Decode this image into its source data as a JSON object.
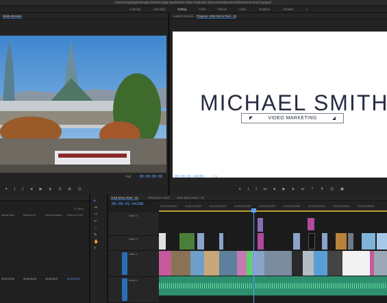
{
  "titlebar": {
    "path": "/Users/Craig/Studio/Dropbox/Work/Craigio Studio/2016 Video Production Demo Reels/premiere/2016 Demo Reel 04.prproj *"
  },
  "workspace_tabs": [
    "Learning",
    "Assembly",
    "Editing",
    "Color",
    "Effects",
    "Audio",
    "Graphics",
    "Libraries",
    "»"
  ],
  "source_panel": {
    "tab": "Media Browser",
    "zoom": "Full",
    "timecode": "00:00:08:08"
  },
  "program_panel": {
    "tabs": [
      "Lumetri Scopes",
      "Program: 2016 Demo Reel - 02"
    ],
    "title": "MICHAEL SMITH",
    "subtitle": "VIDEO MARKETING",
    "timecode": "00:00:01:44188",
    "fit": "Fit"
  },
  "project_panel": {
    "count": "17 Items",
    "columns": [
      "Media Start",
      "Media End",
      "Media Duration",
      "Video In Point"
    ],
    "values": [
      "00;00;00;00",
      "00;00;06;24",
      "00;00;06;27",
      "00;00;00;00"
    ]
  },
  "timeline": {
    "tabs": [
      "2016 Demo Reel - 02",
      "2016 Demo Reel",
      "2016 Demo Reel - 02"
    ],
    "timecode": "00:00:01:44188",
    "ruler": [
      "00;00;05;00000",
      "00;00;10;00000",
      "00;00;15;00000",
      "00;00;20;00000",
      "00;00;25;00000",
      "00;00;30;00000",
      "00;00;35;00000",
      "00;00;40;00000",
      "00;00;45;00000"
    ],
    "tracks": [
      "Video 3",
      "Video 2",
      "Video 1",
      "Audio 1"
    ]
  }
}
